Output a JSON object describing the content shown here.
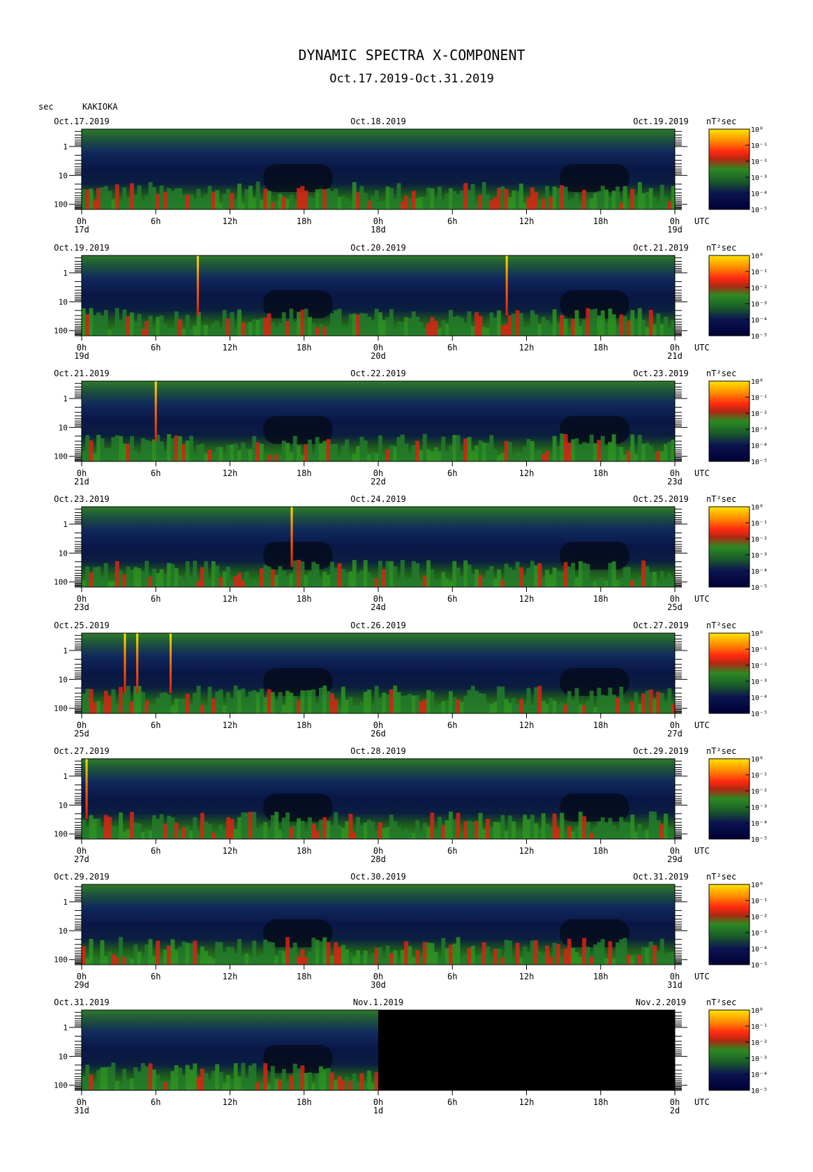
{
  "title": "DYNAMIC SPECTRA X-COMPONENT",
  "subtitle": "Oct.17.2019-Oct.31.2019",
  "station": "KAKIOKA",
  "y_unit": "sec",
  "colorbar_unit": "nT²sec",
  "x_unit_label": "UTC",
  "colors": {
    "background": "#000000",
    "low": "#0b1450",
    "mid": "#1e6e1e",
    "high": "#e02010",
    "max": "#ffe000"
  },
  "chart_data": {
    "type": "heatmap",
    "ylabel": "sec",
    "xlabel": "UTC",
    "y_ticks": [
      "1",
      "10",
      "100"
    ],
    "x_ticks": [
      "0h",
      "6h",
      "12h",
      "18h",
      "0h",
      "6h",
      "12h",
      "18h",
      "0h"
    ],
    "colorbar_ticks": [
      "10⁰",
      "10⁻¹",
      "10⁻²",
      "10⁻³",
      "10⁻⁴",
      "10⁻⁵"
    ],
    "panels": [
      {
        "left_date": "Oct.17.2019",
        "mid_date": "Oct.18.2019",
        "right_date": "Oct.19.2019",
        "days": [
          "17d",
          "18d",
          "19d"
        ],
        "spikes": [],
        "data_until_hours": 48
      },
      {
        "left_date": "Oct.19.2019",
        "mid_date": "Oct.20.2019",
        "right_date": "Oct.21.2019",
        "days": [
          "19d",
          "20d",
          "21d"
        ],
        "spikes": [
          9.4,
          34.4
        ],
        "data_until_hours": 48
      },
      {
        "left_date": "Oct.21.2019",
        "mid_date": "Oct.22.2019",
        "right_date": "Oct.23.2019",
        "days": [
          "21d",
          "22d",
          "23d"
        ],
        "spikes": [
          6.0
        ],
        "data_until_hours": 48
      },
      {
        "left_date": "Oct.23.2019",
        "mid_date": "Oct.24.2019",
        "right_date": "Oct.25.2019",
        "days": [
          "23d",
          "24d",
          "25d"
        ],
        "spikes": [
          17.0
        ],
        "data_until_hours": 48
      },
      {
        "left_date": "Oct.25.2019",
        "mid_date": "Oct.26.2019",
        "right_date": "Oct.27.2019",
        "days": [
          "25d",
          "26d",
          "27d"
        ],
        "spikes": [
          3.5,
          4.5,
          7.2
        ],
        "data_until_hours": 48
      },
      {
        "left_date": "Oct.27.2019",
        "mid_date": "Oct.28.2019",
        "right_date": "Oct.29.2019",
        "days": [
          "27d",
          "28d",
          "29d"
        ],
        "spikes": [
          0.4
        ],
        "data_until_hours": 48
      },
      {
        "left_date": "Oct.29.2019",
        "mid_date": "Oct.30.2019",
        "right_date": "Oct.31.2019",
        "days": [
          "29d",
          "30d",
          "31d"
        ],
        "spikes": [],
        "data_until_hours": 48
      },
      {
        "left_date": "Oct.31.2019",
        "mid_date": "Nov.1.2019",
        "right_date": "Nov.2.2019",
        "days": [
          "31d",
          "1d",
          "2d"
        ],
        "spikes": [],
        "data_until_hours": 24
      }
    ]
  }
}
